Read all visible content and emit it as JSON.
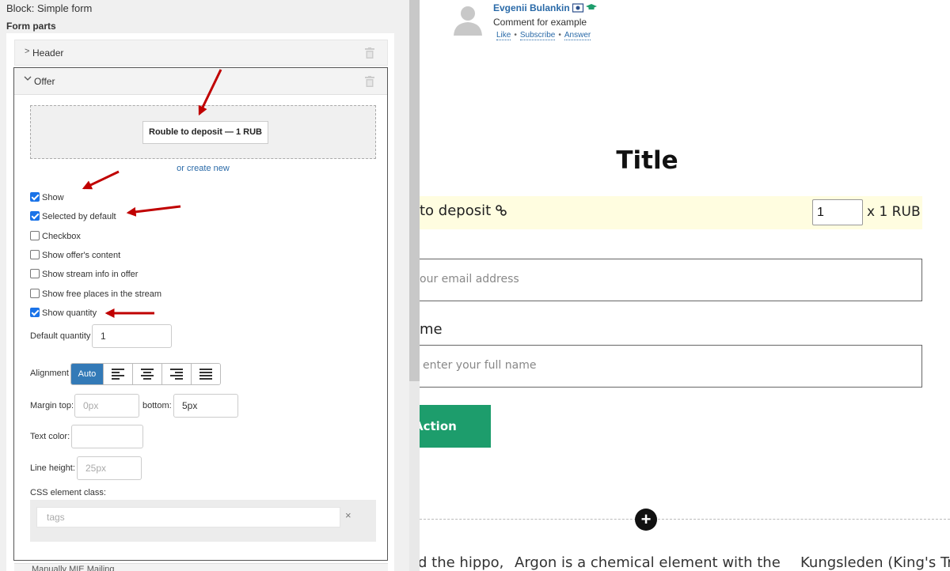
{
  "left": {
    "block_title": "Block: Simple form",
    "form_parts_title": "Form parts",
    "parts": {
      "header": {
        "label": "Header"
      },
      "offer": {
        "label": "Offer"
      },
      "next": {
        "label": "Manually MIE Mailing"
      }
    },
    "offer_chip": "Rouble to deposit — 1 RUB",
    "create_new": "or create new",
    "checkboxes": [
      {
        "label": "Show",
        "checked": true
      },
      {
        "label": "Selected by default",
        "checked": true
      },
      {
        "label": "Checkbox",
        "checked": false
      },
      {
        "label": "Show offer's content",
        "checked": false
      },
      {
        "label": "Show stream info in offer",
        "checked": false
      },
      {
        "label": "Show free places in the stream",
        "checked": false
      },
      {
        "label": "Show quantity",
        "checked": true
      }
    ],
    "default_quantity": {
      "label": "Default quantity",
      "value": "1"
    },
    "alignment": {
      "label": "Alignment",
      "active_label": "Auto",
      "options": [
        "auto",
        "align-left-icon",
        "align-center-icon",
        "align-right-icon",
        "align-justify-icon"
      ]
    },
    "margin": {
      "top_label": "Margin top:",
      "top_placeholder": "0px",
      "bottom_label": "bottom:",
      "bottom_value": "5px"
    },
    "text_color": {
      "label": "Text color:",
      "value": ""
    },
    "line_height": {
      "label": "Line height:",
      "placeholder": "25px"
    },
    "css_class": {
      "label": "CSS element class:",
      "placeholder": "tags",
      "clear": "×"
    }
  },
  "preview": {
    "comment": {
      "author": "Evgenii Bulankin",
      "text": "Comment for example",
      "actions": [
        "Like",
        "Subscribe",
        "Answer"
      ]
    },
    "title": "Title",
    "offer_text": "to deposit",
    "quantity": "1",
    "price": "x 1 RUB",
    "email_placeholder": "our email address",
    "name_label": "me",
    "name_placeholder": "enter your full name",
    "action_label": "Action",
    "add_icon": "+",
    "bottom_texts": [
      "d the hippo,",
      "Argon is a chemical element with the",
      "Kungsleden (King's Trail"
    ]
  },
  "colors": {
    "accent_blue": "#337ab7",
    "action_green": "#1d9d6c",
    "highlight_yellow": "#fffde0",
    "arrow_red": "#c00000"
  }
}
